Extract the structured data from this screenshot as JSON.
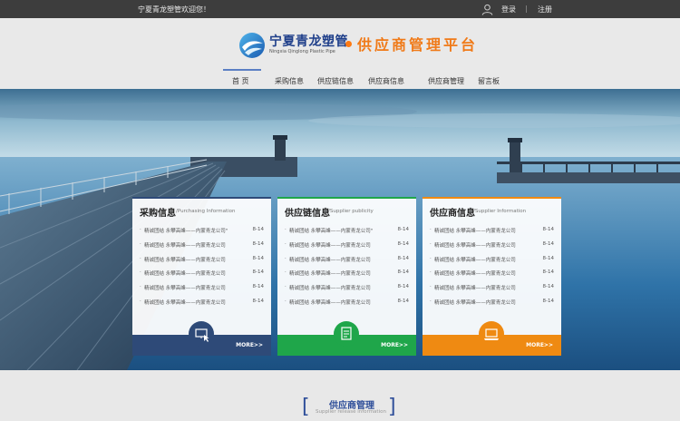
{
  "topbar": {
    "welcome": "宁夏青龙塑管欢迎您！",
    "login": "登录",
    "separator": "|",
    "register": "注册"
  },
  "header": {
    "brand_cn": "宁夏青龙塑管",
    "brand_en": "Ningxia Qinglong Plastic Pipe",
    "slogan": "供应商管理平台"
  },
  "nav": {
    "items": [
      "首 页",
      "采购信息",
      "供应链信息",
      "供应商信息",
      "供应商管理",
      "留言板"
    ],
    "active": "首 页"
  },
  "cards": [
    {
      "title": "采购信息",
      "subtitle": "/Purchasing Information",
      "accent": "#2e4a78",
      "icon": "monitor-cursor-icon",
      "more": "MORE>>",
      "rows": [
        {
          "text": "精诚团结 永攀高峰——内蒙青龙公司\"",
          "date": "8-14"
        },
        {
          "text": "精诚团结 永攀高峰——内蒙青龙公司",
          "date": "8-14"
        },
        {
          "text": "精诚团结 永攀高峰——内蒙青龙公司",
          "date": "8-14"
        },
        {
          "text": "精诚团结 永攀高峰——内蒙青龙公司",
          "date": "8-14"
        },
        {
          "text": "精诚团结 永攀高峰——内蒙青龙公司",
          "date": "8-14"
        },
        {
          "text": "精诚团结 永攀高峰——内蒙青龙公司",
          "date": "8-14"
        }
      ]
    },
    {
      "title": "供应链信息",
      "subtitle": "/Supplier publicity",
      "accent": "#1fa64a",
      "icon": "document-stack-icon",
      "more": "MORE>>",
      "rows": [
        {
          "text": "精诚团结 永攀高峰——内蒙青龙公司\"",
          "date": "8-14"
        },
        {
          "text": "精诚团结 永攀高峰——内蒙青龙公司",
          "date": "8-14"
        },
        {
          "text": "精诚团结 永攀高峰——内蒙青龙公司",
          "date": "8-14"
        },
        {
          "text": "精诚团结 永攀高峰——内蒙青龙公司",
          "date": "8-14"
        },
        {
          "text": "精诚团结 永攀高峰——内蒙青龙公司",
          "date": "8-14"
        },
        {
          "text": "精诚团结 永攀高峰——内蒙青龙公司",
          "date": "8-14"
        }
      ]
    },
    {
      "title": "供应商信息",
      "subtitle": "/Supplier Information",
      "accent": "#ef8a12",
      "icon": "laptop-icon",
      "more": "MORE>>",
      "rows": [
        {
          "text": "精诚团结 永攀高峰——内蒙青龙公司",
          "date": "8-14"
        },
        {
          "text": "精诚团结 永攀高峰——内蒙青龙公司",
          "date": "8-14"
        },
        {
          "text": "精诚团结 永攀高峰——内蒙青龙公司",
          "date": "8-14"
        },
        {
          "text": "精诚团结 永攀高峰——内蒙青龙公司",
          "date": "8-14"
        },
        {
          "text": "精诚团结 永攀高峰——内蒙青龙公司",
          "date": "8-14"
        },
        {
          "text": "精诚团结 永攀高峰——内蒙青龙公司",
          "date": "8-14"
        }
      ]
    }
  ],
  "section": {
    "title": "供应商管理",
    "subtitle": "Supplier release information",
    "bracket_left": "[",
    "bracket_right": "]"
  }
}
